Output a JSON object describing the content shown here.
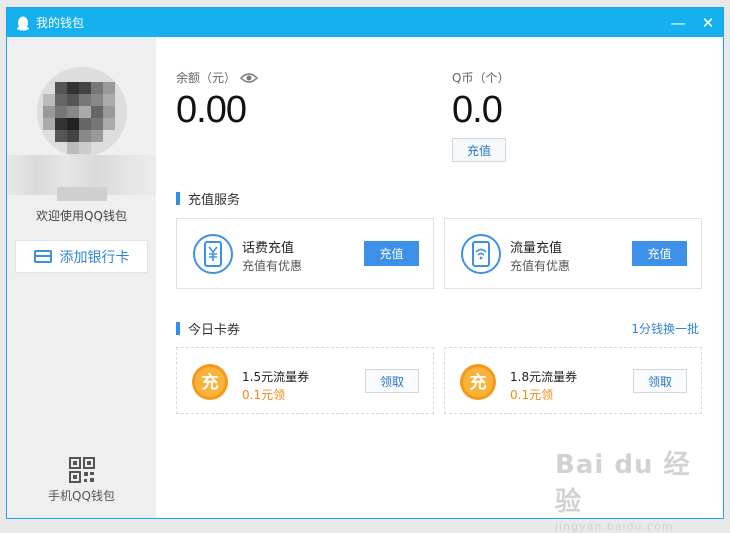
{
  "window": {
    "title": "我的钱包",
    "minimize_symbol": "—",
    "close_symbol": "✕"
  },
  "sidebar": {
    "welcome_text": "欢迎使用QQ钱包",
    "add_bank_label": "添加银行卡",
    "mobile_wallet_label": "手机QQ钱包"
  },
  "balance": {
    "label": "余额（元）",
    "value": "0.00"
  },
  "qcoin": {
    "label": "Q币（个）",
    "value": "0.0",
    "recharge_label": "充值"
  },
  "recharge_services": {
    "title": "充值服务",
    "items": [
      {
        "title": "话费充值",
        "subtitle": "充值有优惠",
        "button": "充值",
        "icon": "yen-phone-icon"
      },
      {
        "title": "流量充值",
        "subtitle": "充值有优惠",
        "button": "充值",
        "icon": "wifi-phone-icon"
      }
    ]
  },
  "coupons": {
    "title": "今日卡券",
    "exchange_link": "1分钱换一批",
    "items": [
      {
        "badge": "充",
        "title": "1.5元流量券",
        "price": "0.1元领",
        "button": "领取"
      },
      {
        "badge": "充",
        "title": "1.8元流量券",
        "price": "0.1元领",
        "button": "领取"
      }
    ]
  },
  "watermark": {
    "brand": "Bai du 经验",
    "url": "jingyan.baidu.com"
  },
  "colors": {
    "titlebar": "#14b0f0",
    "accent": "#3d90e8",
    "orange": "#f08a18"
  }
}
